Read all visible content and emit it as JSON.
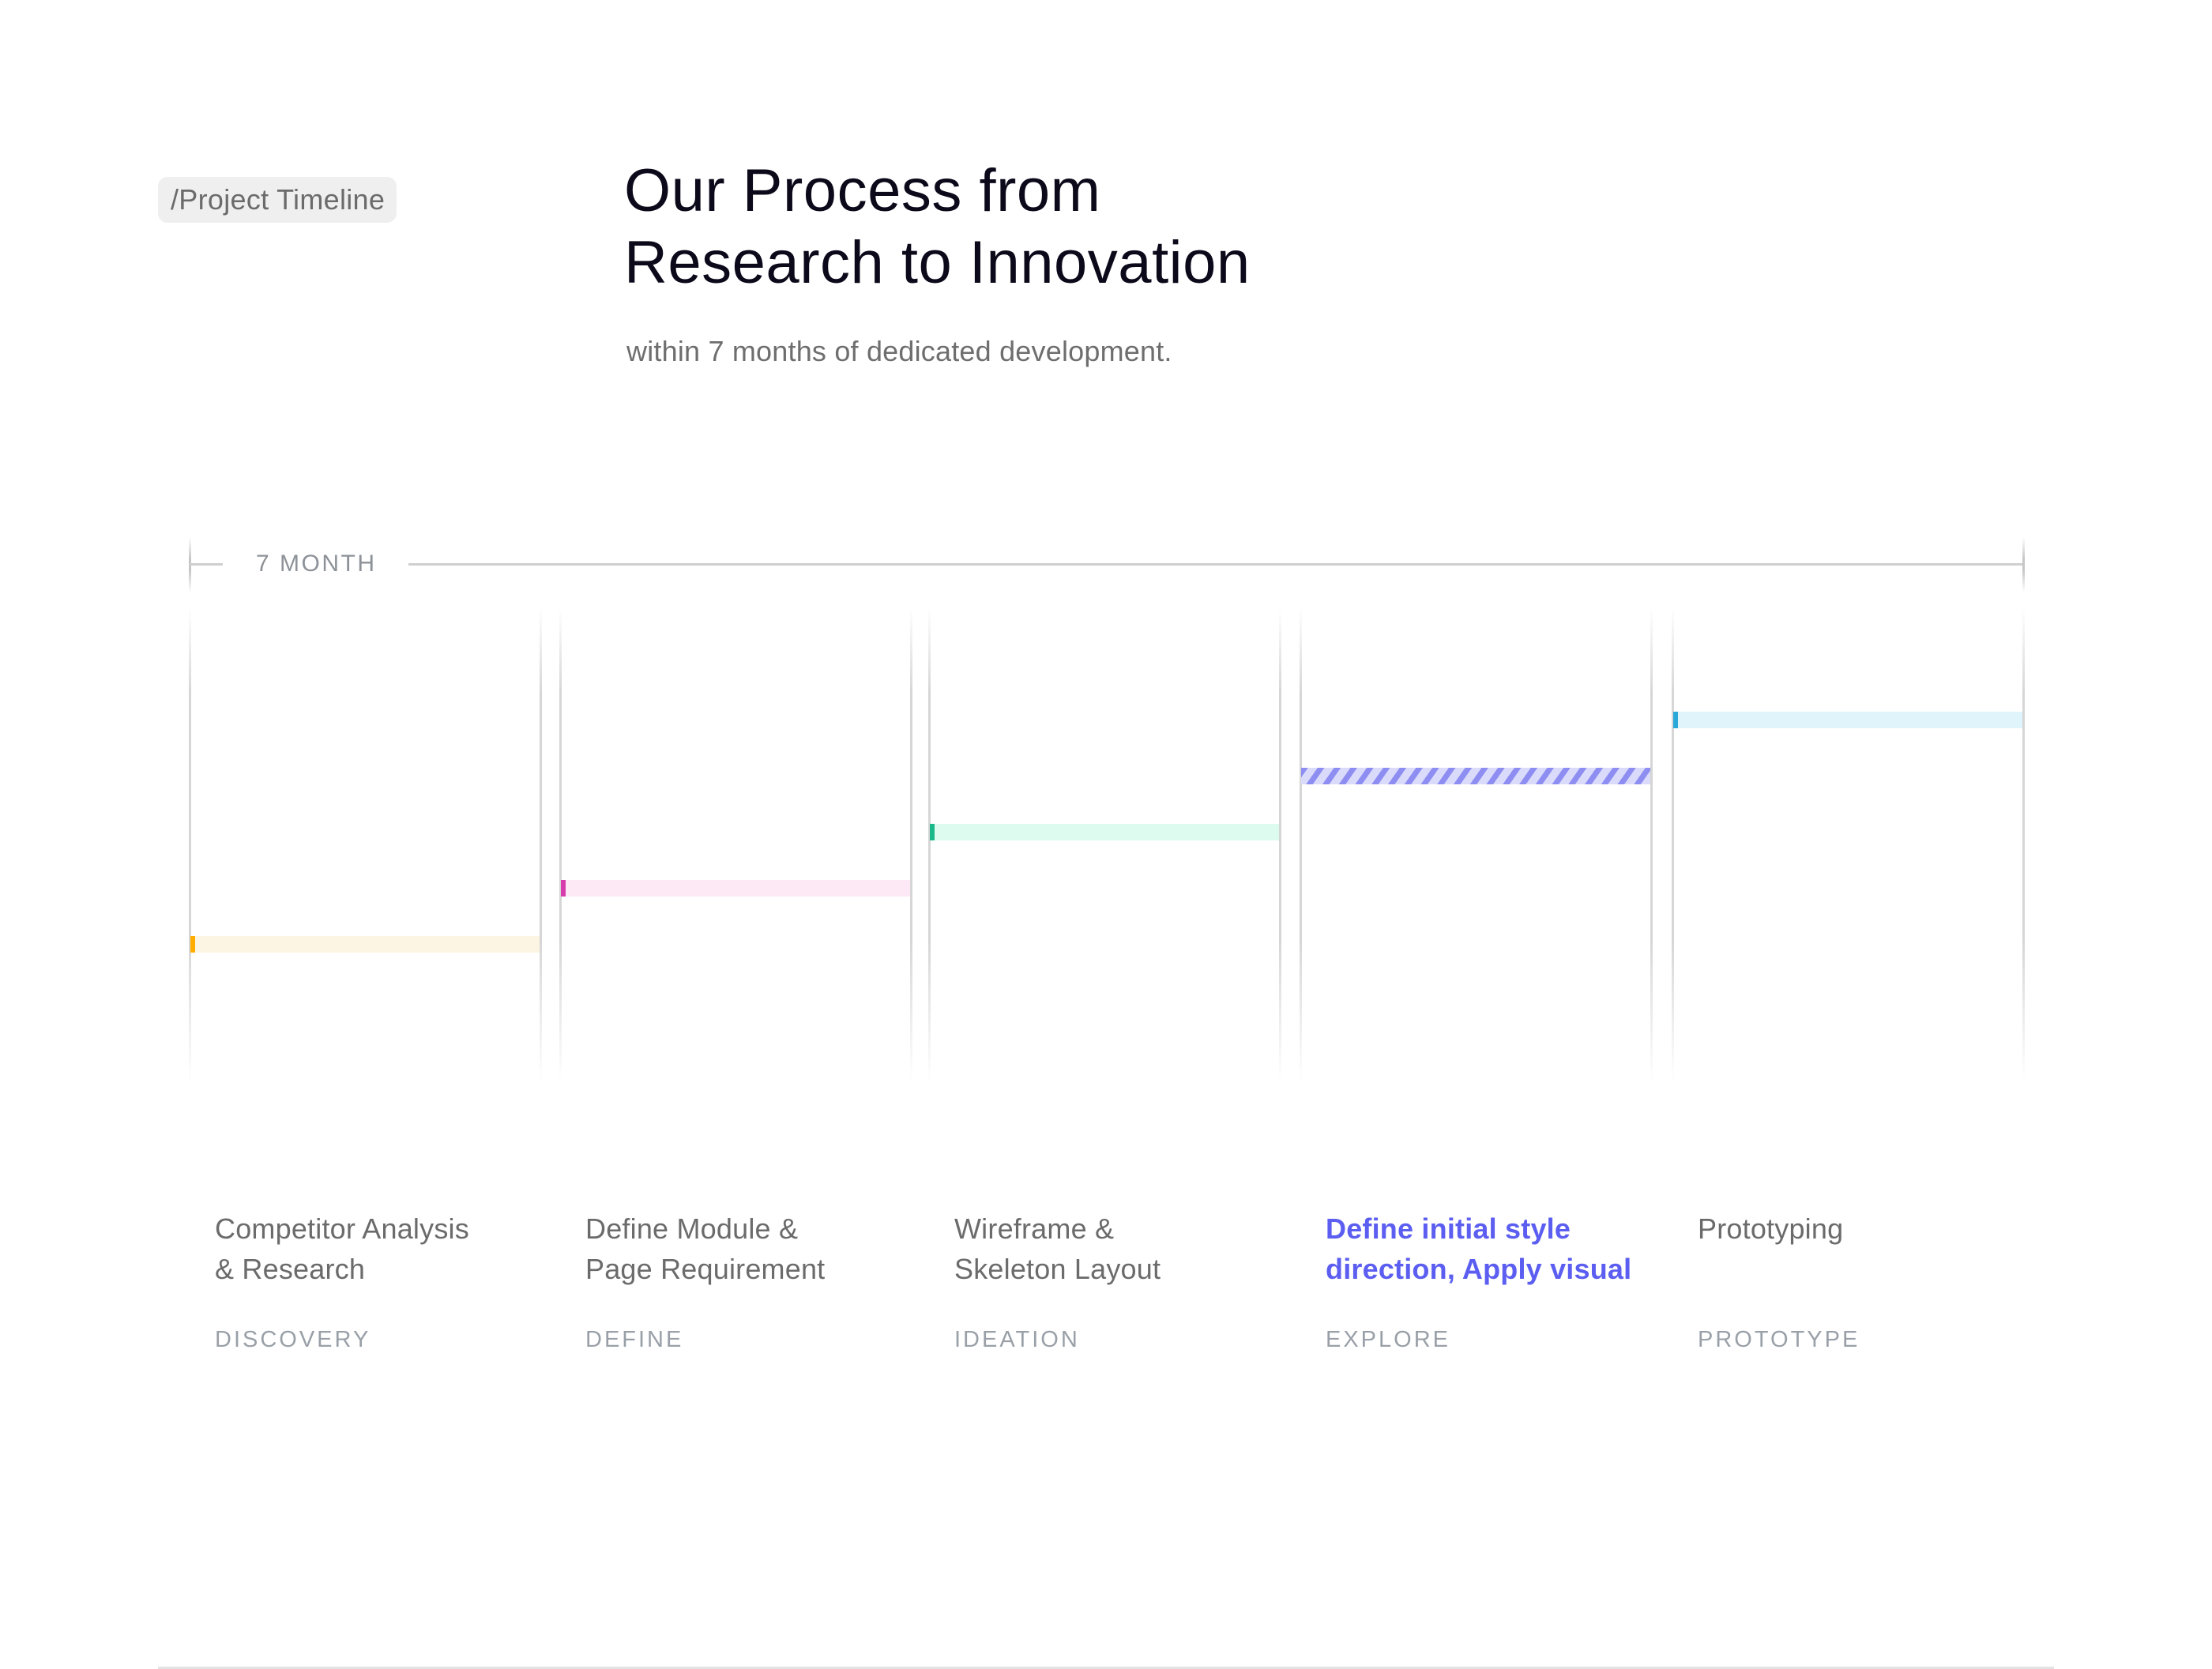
{
  "badge": {
    "label": "/Project Timeline"
  },
  "header": {
    "title_lines": [
      "Our Process from",
      "Research to Innovation"
    ],
    "subtitle": "within 7 months of dedicated development."
  },
  "timeline": {
    "duration_label": "7 MONTH",
    "steps": [
      {
        "title_lines": [
          "Competitor Analysis",
          "& Research"
        ],
        "phase": "DISCOVERY",
        "accent_color": "#ffae00",
        "bar_color": "#fdf5e4",
        "active": false,
        "style": "solid"
      },
      {
        "title_lines": [
          "Define Module &",
          "Page Requirement"
        ],
        "phase": "DEFINE",
        "accent_color": "#d63cae",
        "bar_color": "#fde8f6",
        "active": false,
        "style": "solid"
      },
      {
        "title_lines": [
          "Wireframe &",
          "Skeleton Layout"
        ],
        "phase": "IDEATION",
        "accent_color": "#1bb98a",
        "bar_color": "#ddfbef",
        "active": false,
        "style": "solid"
      },
      {
        "title_lines": [
          "Define initial style",
          "direction, Apply visual"
        ],
        "phase": "EXPLORE",
        "accent_color": "#8e8ef2",
        "bar_color": "#dadafa",
        "active": true,
        "style": "hatched"
      },
      {
        "title_lines": [
          "Prototyping"
        ],
        "phase": "PROTOTYPE",
        "accent_color": "#2aa9d9",
        "bar_color": "#e0f4fb",
        "active": false,
        "style": "solid"
      }
    ]
  }
}
